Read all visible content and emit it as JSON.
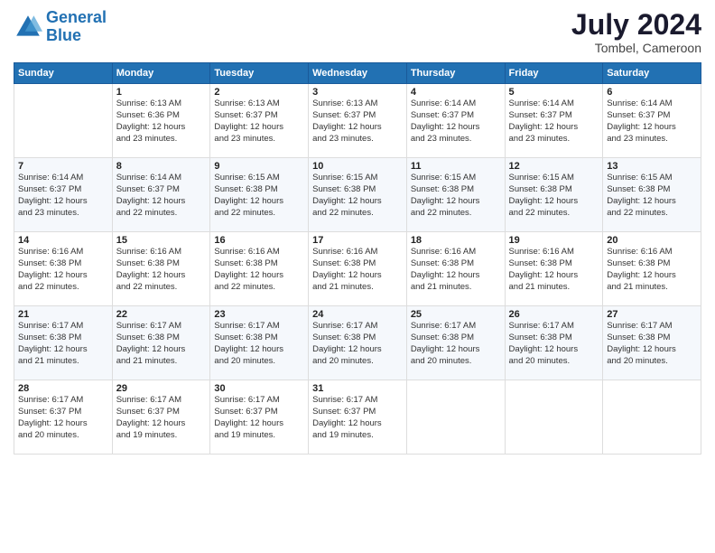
{
  "header": {
    "logo_line1": "General",
    "logo_line2": "Blue",
    "month_year": "July 2024",
    "location": "Tombel, Cameroon"
  },
  "calendar": {
    "days_of_week": [
      "Sunday",
      "Monday",
      "Tuesday",
      "Wednesday",
      "Thursday",
      "Friday",
      "Saturday"
    ],
    "weeks": [
      [
        {
          "day": "",
          "info": ""
        },
        {
          "day": "1",
          "info": "Sunrise: 6:13 AM\nSunset: 6:36 PM\nDaylight: 12 hours\nand 23 minutes."
        },
        {
          "day": "2",
          "info": "Sunrise: 6:13 AM\nSunset: 6:37 PM\nDaylight: 12 hours\nand 23 minutes."
        },
        {
          "day": "3",
          "info": "Sunrise: 6:13 AM\nSunset: 6:37 PM\nDaylight: 12 hours\nand 23 minutes."
        },
        {
          "day": "4",
          "info": "Sunrise: 6:14 AM\nSunset: 6:37 PM\nDaylight: 12 hours\nand 23 minutes."
        },
        {
          "day": "5",
          "info": "Sunrise: 6:14 AM\nSunset: 6:37 PM\nDaylight: 12 hours\nand 23 minutes."
        },
        {
          "day": "6",
          "info": "Sunrise: 6:14 AM\nSunset: 6:37 PM\nDaylight: 12 hours\nand 23 minutes."
        }
      ],
      [
        {
          "day": "7",
          "info": "Sunrise: 6:14 AM\nSunset: 6:37 PM\nDaylight: 12 hours\nand 23 minutes."
        },
        {
          "day": "8",
          "info": "Sunrise: 6:14 AM\nSunset: 6:37 PM\nDaylight: 12 hours\nand 22 minutes."
        },
        {
          "day": "9",
          "info": "Sunrise: 6:15 AM\nSunset: 6:38 PM\nDaylight: 12 hours\nand 22 minutes."
        },
        {
          "day": "10",
          "info": "Sunrise: 6:15 AM\nSunset: 6:38 PM\nDaylight: 12 hours\nand 22 minutes."
        },
        {
          "day": "11",
          "info": "Sunrise: 6:15 AM\nSunset: 6:38 PM\nDaylight: 12 hours\nand 22 minutes."
        },
        {
          "day": "12",
          "info": "Sunrise: 6:15 AM\nSunset: 6:38 PM\nDaylight: 12 hours\nand 22 minutes."
        },
        {
          "day": "13",
          "info": "Sunrise: 6:15 AM\nSunset: 6:38 PM\nDaylight: 12 hours\nand 22 minutes."
        }
      ],
      [
        {
          "day": "14",
          "info": "Sunrise: 6:16 AM\nSunset: 6:38 PM\nDaylight: 12 hours\nand 22 minutes."
        },
        {
          "day": "15",
          "info": "Sunrise: 6:16 AM\nSunset: 6:38 PM\nDaylight: 12 hours\nand 22 minutes."
        },
        {
          "day": "16",
          "info": "Sunrise: 6:16 AM\nSunset: 6:38 PM\nDaylight: 12 hours\nand 22 minutes."
        },
        {
          "day": "17",
          "info": "Sunrise: 6:16 AM\nSunset: 6:38 PM\nDaylight: 12 hours\nand 21 minutes."
        },
        {
          "day": "18",
          "info": "Sunrise: 6:16 AM\nSunset: 6:38 PM\nDaylight: 12 hours\nand 21 minutes."
        },
        {
          "day": "19",
          "info": "Sunrise: 6:16 AM\nSunset: 6:38 PM\nDaylight: 12 hours\nand 21 minutes."
        },
        {
          "day": "20",
          "info": "Sunrise: 6:16 AM\nSunset: 6:38 PM\nDaylight: 12 hours\nand 21 minutes."
        }
      ],
      [
        {
          "day": "21",
          "info": "Sunrise: 6:17 AM\nSunset: 6:38 PM\nDaylight: 12 hours\nand 21 minutes."
        },
        {
          "day": "22",
          "info": "Sunrise: 6:17 AM\nSunset: 6:38 PM\nDaylight: 12 hours\nand 21 minutes."
        },
        {
          "day": "23",
          "info": "Sunrise: 6:17 AM\nSunset: 6:38 PM\nDaylight: 12 hours\nand 20 minutes."
        },
        {
          "day": "24",
          "info": "Sunrise: 6:17 AM\nSunset: 6:38 PM\nDaylight: 12 hours\nand 20 minutes."
        },
        {
          "day": "25",
          "info": "Sunrise: 6:17 AM\nSunset: 6:38 PM\nDaylight: 12 hours\nand 20 minutes."
        },
        {
          "day": "26",
          "info": "Sunrise: 6:17 AM\nSunset: 6:38 PM\nDaylight: 12 hours\nand 20 minutes."
        },
        {
          "day": "27",
          "info": "Sunrise: 6:17 AM\nSunset: 6:38 PM\nDaylight: 12 hours\nand 20 minutes."
        }
      ],
      [
        {
          "day": "28",
          "info": "Sunrise: 6:17 AM\nSunset: 6:37 PM\nDaylight: 12 hours\nand 20 minutes."
        },
        {
          "day": "29",
          "info": "Sunrise: 6:17 AM\nSunset: 6:37 PM\nDaylight: 12 hours\nand 19 minutes."
        },
        {
          "day": "30",
          "info": "Sunrise: 6:17 AM\nSunset: 6:37 PM\nDaylight: 12 hours\nand 19 minutes."
        },
        {
          "day": "31",
          "info": "Sunrise: 6:17 AM\nSunset: 6:37 PM\nDaylight: 12 hours\nand 19 minutes."
        },
        {
          "day": "",
          "info": ""
        },
        {
          "day": "",
          "info": ""
        },
        {
          "day": "",
          "info": ""
        }
      ]
    ]
  }
}
